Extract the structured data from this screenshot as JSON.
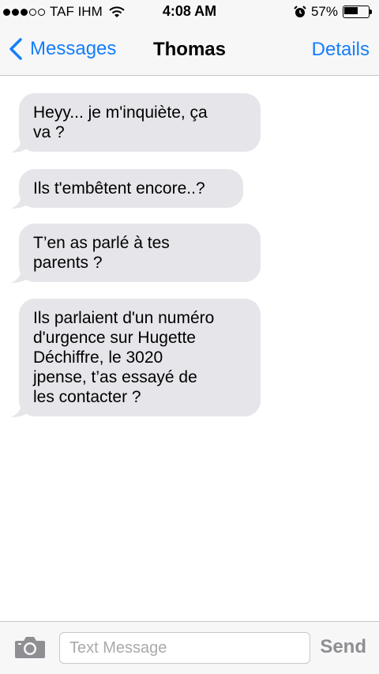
{
  "status_bar": {
    "carrier": "TAF IHM",
    "time": "4:08 AM",
    "battery": "57%",
    "battery_level": 0.57,
    "signal_bars_filled": 3,
    "signal_bars_total": 5
  },
  "nav": {
    "back_label": "Messages",
    "title": "Thomas",
    "details_label": "Details"
  },
  "messages": [
    {
      "lines": [
        "Heyy... je m'inquiète, ça",
        "va ?"
      ]
    },
    {
      "lines": [
        "Ils t'embêtent encore..?"
      ]
    },
    {
      "lines": [
        "T’en as parlé à tes",
        "parents ?"
      ]
    },
    {
      "lines": [
        "Ils parlaient d'un numéro",
        "d'urgence sur Hugette",
        "Déchiffre, le 3020",
        "jpense, t’as essayé de",
        "les contacter ?"
      ]
    }
  ],
  "input": {
    "placeholder": "Text Message",
    "value": "",
    "send_label": "Send"
  },
  "colors": {
    "accent": "#147efb",
    "bubble_received": "#e5e5ea",
    "send_disabled": "#8e8e93"
  },
  "icons": [
    "wifi-icon",
    "alarm-icon",
    "battery-icon",
    "chevron-left-icon",
    "camera-icon"
  ]
}
